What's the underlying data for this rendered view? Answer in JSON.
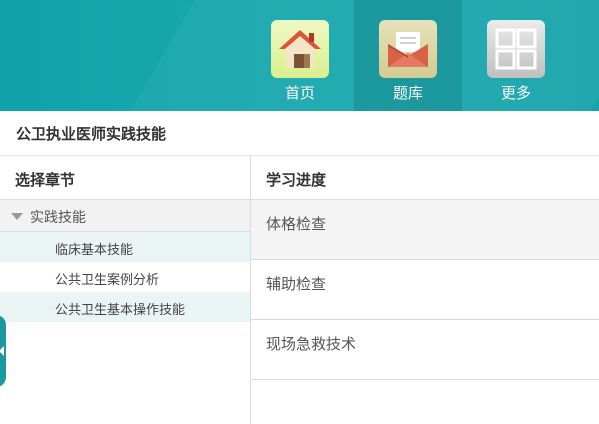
{
  "nav": {
    "items": [
      {
        "label": "首页",
        "icon": "home-icon"
      },
      {
        "label": "题库",
        "icon": "envelope-icon"
      },
      {
        "label": "更多",
        "icon": "grid-icon"
      }
    ],
    "active_index": 1
  },
  "page": {
    "title": "公卫执业医师实践技能"
  },
  "chapters": {
    "header": "选择章节",
    "root": {
      "label": "实践技能",
      "expanded": true
    },
    "children": [
      {
        "label": "临床基本技能",
        "highlighted": true
      },
      {
        "label": "公共卫生案例分析",
        "highlighted": false
      },
      {
        "label": "公共卫生基本操作技能",
        "highlighted": true
      }
    ]
  },
  "progress": {
    "header": "学习进度",
    "items": [
      {
        "label": "体格检查"
      },
      {
        "label": "辅助检查"
      },
      {
        "label": "现场急救技术"
      }
    ]
  },
  "colors": {
    "accent": "#16a4aa",
    "side_tab": "#1a9aa0",
    "highlight": "#eaf4f4"
  }
}
